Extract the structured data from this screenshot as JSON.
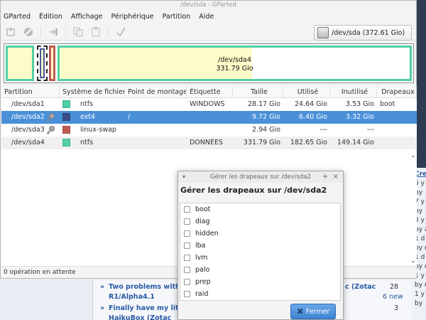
{
  "window": {
    "title": "/dev/sda - GParted"
  },
  "menu": [
    "GParted",
    "Édition",
    "Affichage",
    "Périphérique",
    "Partition",
    "Aide"
  ],
  "device_selector": {
    "value": "/dev/sda   (372.61 Gio)"
  },
  "map": {
    "main_label": "/dev/sda4",
    "main_size": "331.79 Gio"
  },
  "table": {
    "headers": [
      "Partition",
      "Système de fichiers",
      "Point de montage",
      "Étiquette",
      "Taille",
      "Utilisé",
      "Inutilisé",
      "Drapeaux"
    ],
    "rows": [
      {
        "partition": "/dev/sda1",
        "fs": "ntfs",
        "mount": "",
        "label": "WINDOWS",
        "size": "28.17 Gio",
        "used": "24.64 Gio",
        "unused": "3.53 Gio",
        "flags": "boot",
        "color": "#4fd0a4",
        "key": false
      },
      {
        "partition": "/dev/sda2",
        "fs": "ext4",
        "mount": "/",
        "label": "",
        "size": "9.72 Gio",
        "used": "6.40 Gio",
        "unused": "3.32 Gio",
        "flags": "",
        "color": "#3c4d88",
        "key": true
      },
      {
        "partition": "/dev/sda3",
        "fs": "linux-swap",
        "mount": "",
        "label": "",
        "size": "2.94 Gio",
        "used": "---",
        "unused": "---",
        "flags": "",
        "color": "#c05a50",
        "key": true
      },
      {
        "partition": "/dev/sda4",
        "fs": "ntfs",
        "mount": "",
        "label": "DONNEES",
        "size": "331.79 Gio",
        "used": "182.65 Gio",
        "unused": "149.14 Gio",
        "flags": "",
        "color": "#4fd0a4",
        "key": false
      }
    ]
  },
  "status": {
    "text": "0 opération en attente"
  },
  "dialog": {
    "title": "Gérer les drapeaux sur /dev/sda2",
    "heading": "Gérer les drapeaux sur /dev/sda2",
    "flags": [
      "boot",
      "diag",
      "hidden",
      "lba",
      "lvm",
      "palo",
      "prep",
      "raid"
    ],
    "close_label": "Fermer"
  },
  "background": {
    "topics": [
      {
        "title1": "Two problems with",
        "title2": "R1/Alpha4.1",
        "extra": "c (Zotac",
        "num": "28",
        "new": "6 new"
      },
      {
        "title1": "Finally have my litt",
        "title2": "HaikuBox (Zotac",
        "num": "3"
      }
    ],
    "right_snippets": [
      "Cre",
      "5 y",
      "by",
      "7 y",
      "by",
      "3 y",
      "by a",
      "1 d",
      "by r",
      "1 d",
      "by d",
      "1 y",
      "by m",
      "1 y",
      "by"
    ]
  },
  "colors": {
    "selection": "#4a90d9",
    "ntfs": "#4fd0a4",
    "ext4": "#3c4d88",
    "swap": "#c05a50",
    "unalloc_fill": "#fdfbc8"
  }
}
